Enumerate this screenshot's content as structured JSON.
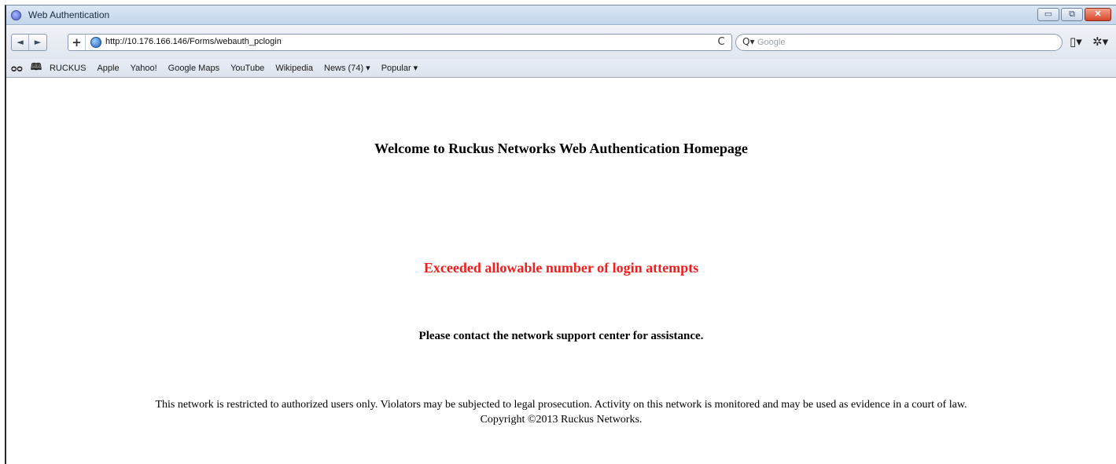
{
  "window": {
    "title": "Web Authentication",
    "controls": {
      "minimize": "▭",
      "maximize": "⧉",
      "close": "✕"
    }
  },
  "nav": {
    "back_icon": "◄",
    "forward_icon": "►",
    "add_icon": "+",
    "url": "http://10.176.166.146/Forms/webauth_pclogin",
    "reload_icon": "C",
    "search_placeholder": "Google",
    "search_icon": "Q▾",
    "page_menu_icon": "▯▾",
    "tools_menu_icon": "✲▾"
  },
  "bookmarks": {
    "reading_list_icon": "ᴑᴑ",
    "bookmarks_icon": "🕮",
    "items": [
      "RUCKUS",
      "Apple",
      "Yahoo!",
      "Google Maps",
      "YouTube",
      "Wikipedia",
      "News (74) ▾",
      "Popular ▾"
    ]
  },
  "page": {
    "welcome": "Welcome to Ruckus Networks Web Authentication Homepage",
    "error": "Exceeded allowable number of login attempts",
    "contact": "Please contact the network support center for assistance.",
    "disclaimer": "This network is restricted to authorized users only. Violators may be subjected to legal prosecution. Activity on this network is monitored and may be used as evidence in a court of law.",
    "copyright": "Copyright ©2013 Ruckus Networks."
  },
  "colors": {
    "error_text": "#f21d1d",
    "titlebar": "#c3d5eb"
  }
}
